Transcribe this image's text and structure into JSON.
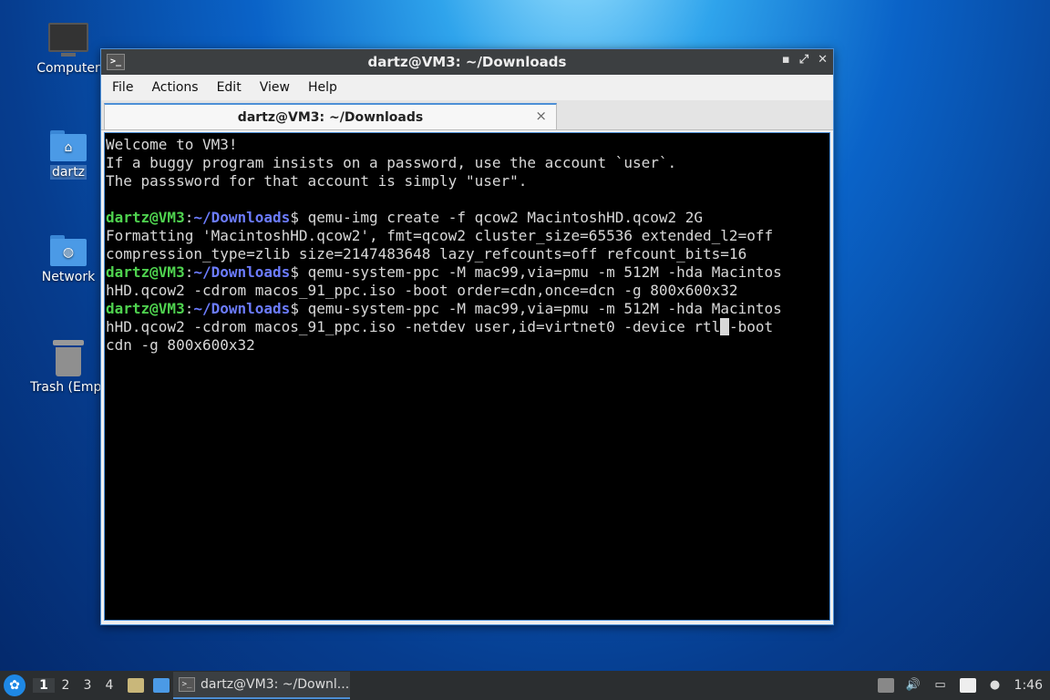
{
  "desktop": {
    "icons": [
      {
        "label": "Computer"
      },
      {
        "label": "dartz"
      },
      {
        "label": "Network"
      },
      {
        "label": "Trash (Empt"
      }
    ]
  },
  "window": {
    "title": "dartz@VM3: ~/Downloads",
    "menu": [
      "File",
      "Actions",
      "Edit",
      "View",
      "Help"
    ],
    "tab_title": "dartz@VM3: ~/Downloads",
    "close_tab": "×"
  },
  "terminal": {
    "welcome": [
      "Welcome to VM3!",
      "If a buggy program insists on a password, use the account `user`.",
      "The passsword for that account is simply \"user\"."
    ],
    "prompt_user": "dartz@VM3",
    "prompt_sep": ":",
    "prompt_path": "~/Downloads",
    "prompt_end": "$",
    "cmd1": " qemu-img create -f qcow2 MacintoshHD.qcow2 2G",
    "out1": [
      "Formatting 'MacintoshHD.qcow2', fmt=qcow2 cluster_size=65536 extended_l2=off",
      "compression_type=zlib size=2147483648 lazy_refcounts=off refcount_bits=16"
    ],
    "cmd2_a": " qemu-system-ppc -M mac99,via=pmu -m 512M -hda Macintos",
    "cmd2_b": "hHD.qcow2 -cdrom macos_91_ppc.iso -boot order=cdn,once=dcn -g 800x600x32",
    "cmd3_a": " qemu-system-ppc -M mac99,via=pmu -m 512M -hda Macintos",
    "cmd3_b1": "hHD.qcow2 -cdrom macos_91_ppc.iso -netdev user,id=virtnet0 -device rtl",
    "cmd3_cursor": " ",
    "cmd3_b2": "-boot",
    "cmd3_c": "cdn -g 800x600x32"
  },
  "taskbar": {
    "workspaces": [
      "1",
      "2",
      "3",
      "4"
    ],
    "task_label": "dartz@VM3: ~/Downl...",
    "clock": "1:46"
  }
}
